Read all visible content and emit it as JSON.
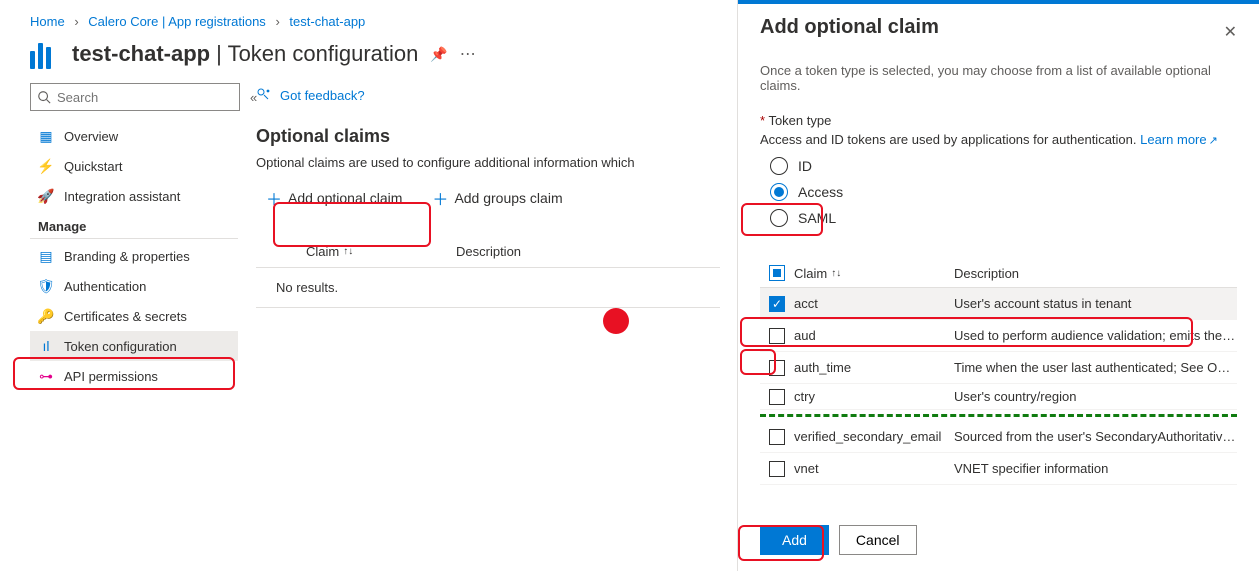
{
  "breadcrumb": {
    "home": "Home",
    "l1": "Calero Core | App registrations",
    "l2": "test-chat-app"
  },
  "title": {
    "app": "test-chat-app",
    "page": "Token configuration"
  },
  "search": {
    "placeholder": "Search"
  },
  "nav": {
    "overview": "Overview",
    "quickstart": "Quickstart",
    "integration": "Integration assistant",
    "manage_header": "Manage",
    "branding": "Branding & properties",
    "authentication": "Authentication",
    "certs": "Certificates & secrets",
    "token": "Token configuration",
    "api": "API permissions"
  },
  "feedback": "Got feedback?",
  "section": {
    "title": "Optional claims",
    "desc": "Optional claims are used to configure additional information which",
    "add_optional": "Add optional claim",
    "add_groups": "Add groups claim"
  },
  "table": {
    "claim": "Claim",
    "desc": "Description",
    "no_results": "No results."
  },
  "panel": {
    "title": "Add optional claim",
    "intro": "Once a token type is selected, you may choose from a list of available optional claims.",
    "token_type_label": "Token type",
    "token_hint": "Access and ID tokens are used by applications for authentication.",
    "learn_more": "Learn more",
    "radios": {
      "id": "ID",
      "access": "Access",
      "saml": "SAML"
    },
    "col_claim": "Claim",
    "col_desc": "Description",
    "rows": [
      {
        "name": "acct",
        "desc": "User's account status in tenant",
        "checked": true
      },
      {
        "name": "aud",
        "desc": "Used to perform audience validation; emits the client ID…",
        "checked": false
      },
      {
        "name": "auth_time",
        "desc": "Time when the user last authenticated; See OpenID Con…",
        "checked": false
      },
      {
        "name": "ctry",
        "desc": "User's country/region",
        "checked": false
      }
    ],
    "rows2": [
      {
        "name": "verified_secondary_email",
        "desc": "Sourced from the user's SecondaryAuthoritativeEmail",
        "checked": false
      },
      {
        "name": "vnet",
        "desc": "VNET specifier information",
        "checked": false
      }
    ],
    "add_btn": "Add",
    "cancel_btn": "Cancel"
  },
  "chart_data": {
    "type": "table"
  }
}
